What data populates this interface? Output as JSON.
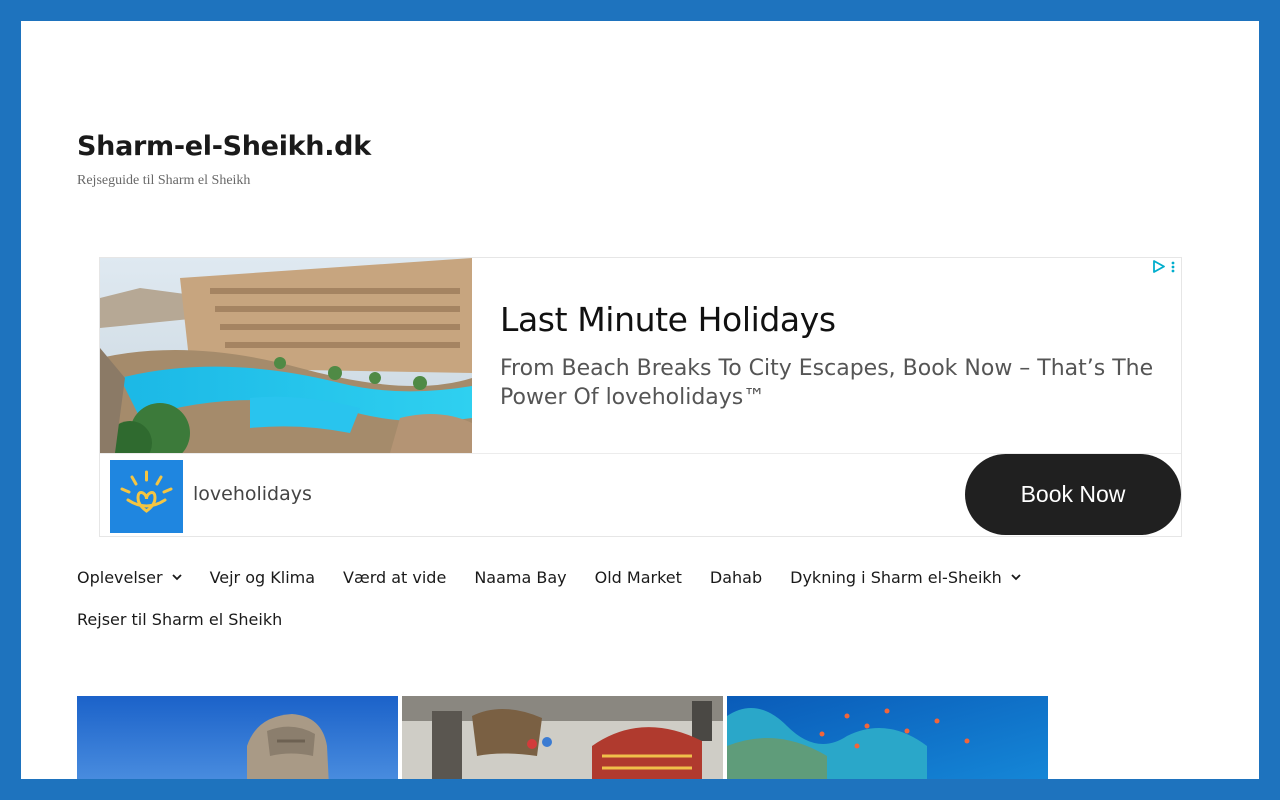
{
  "site": {
    "title": "Sharm-el-Sheikh.dk",
    "description": "Rejseguide til Sharm el Sheikh"
  },
  "ad": {
    "headline": "Last Minute Holidays",
    "body": "From Beach Breaks To City Escapes, Book Now – That’s The Power Of loveholidays™",
    "advertiser": "loveholidays",
    "cta": "Book Now",
    "image_icon": "resort-pool-photo",
    "logo_icon": "sun-heart-logo-icon",
    "adchoices_icon": "adchoices-play-icon",
    "menu_icon": "vertical-dots-icon"
  },
  "nav": {
    "items": [
      {
        "label": "Oplevelser",
        "has_submenu": true
      },
      {
        "label": "Vejr og Klima",
        "has_submenu": false
      },
      {
        "label": "Værd at vide",
        "has_submenu": false
      },
      {
        "label": "Naama Bay",
        "has_submenu": false
      },
      {
        "label": "Old Market",
        "has_submenu": false
      },
      {
        "label": "Dahab",
        "has_submenu": false
      },
      {
        "label": "Dykning i Sharm el-Sheikh",
        "has_submenu": true
      },
      {
        "label": "Rejser til Sharm el Sheikh",
        "has_submenu": false
      }
    ]
  },
  "gallery": {
    "images": [
      "sphinx-photo",
      "camel-market-photo",
      "coral-reef-photo"
    ]
  },
  "colors": {
    "frame": "#1e73be",
    "text": "#1a1a1a",
    "cta_bg": "#202020",
    "logo_bg": "#1f86e0"
  }
}
